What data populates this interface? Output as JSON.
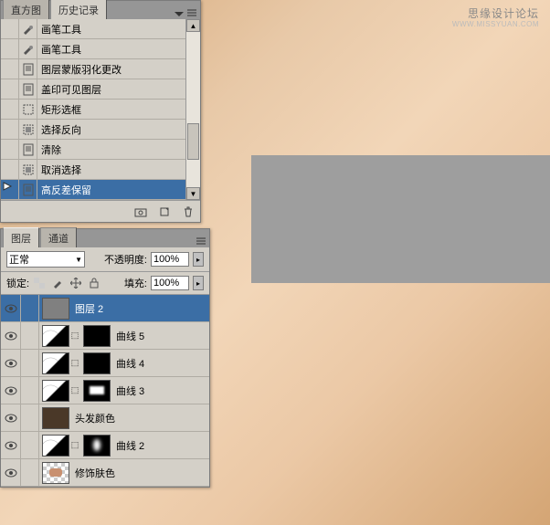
{
  "watermark": {
    "main": "思缘设计论坛",
    "sub": "WWW.MISSYUAN.COM"
  },
  "history_panel": {
    "tabs": [
      "直方图",
      "历史记录"
    ],
    "active_tab": 1,
    "items": [
      {
        "icon": "brush",
        "label": "画笔工具"
      },
      {
        "icon": "brush",
        "label": "画笔工具"
      },
      {
        "icon": "doc",
        "label": "图层蒙版羽化更改"
      },
      {
        "icon": "doc",
        "label": "盖印可见图层"
      },
      {
        "icon": "marquee",
        "label": "矩形选框"
      },
      {
        "icon": "select",
        "label": "选择反向"
      },
      {
        "icon": "doc",
        "label": "清除"
      },
      {
        "icon": "select",
        "label": "取消选择"
      },
      {
        "icon": "doc",
        "label": "高反差保留",
        "selected": true
      }
    ]
  },
  "layers_panel": {
    "tabs": [
      "图层",
      "通道"
    ],
    "active_tab": 0,
    "blend_mode": "正常",
    "opacity_label": "不透明度:",
    "opacity_value": "100%",
    "lock_label": "锁定:",
    "fill_label": "填充:",
    "fill_value": "100%",
    "layers": [
      {
        "thumb": "grey",
        "mask": null,
        "label": "图层 2",
        "selected": true
      },
      {
        "thumb": "curves",
        "mask": "black",
        "label": "曲线 5"
      },
      {
        "thumb": "curves",
        "mask": "black",
        "label": "曲线 4"
      },
      {
        "thumb": "curves",
        "mask": "mask1",
        "label": "曲线 3"
      },
      {
        "thumb": "hair",
        "mask": null,
        "label": "头发颜色"
      },
      {
        "thumb": "curves",
        "mask": "mask2",
        "label": "曲线 2"
      },
      {
        "thumb": "checker",
        "mask": null,
        "label": "修饰肤色"
      }
    ]
  }
}
